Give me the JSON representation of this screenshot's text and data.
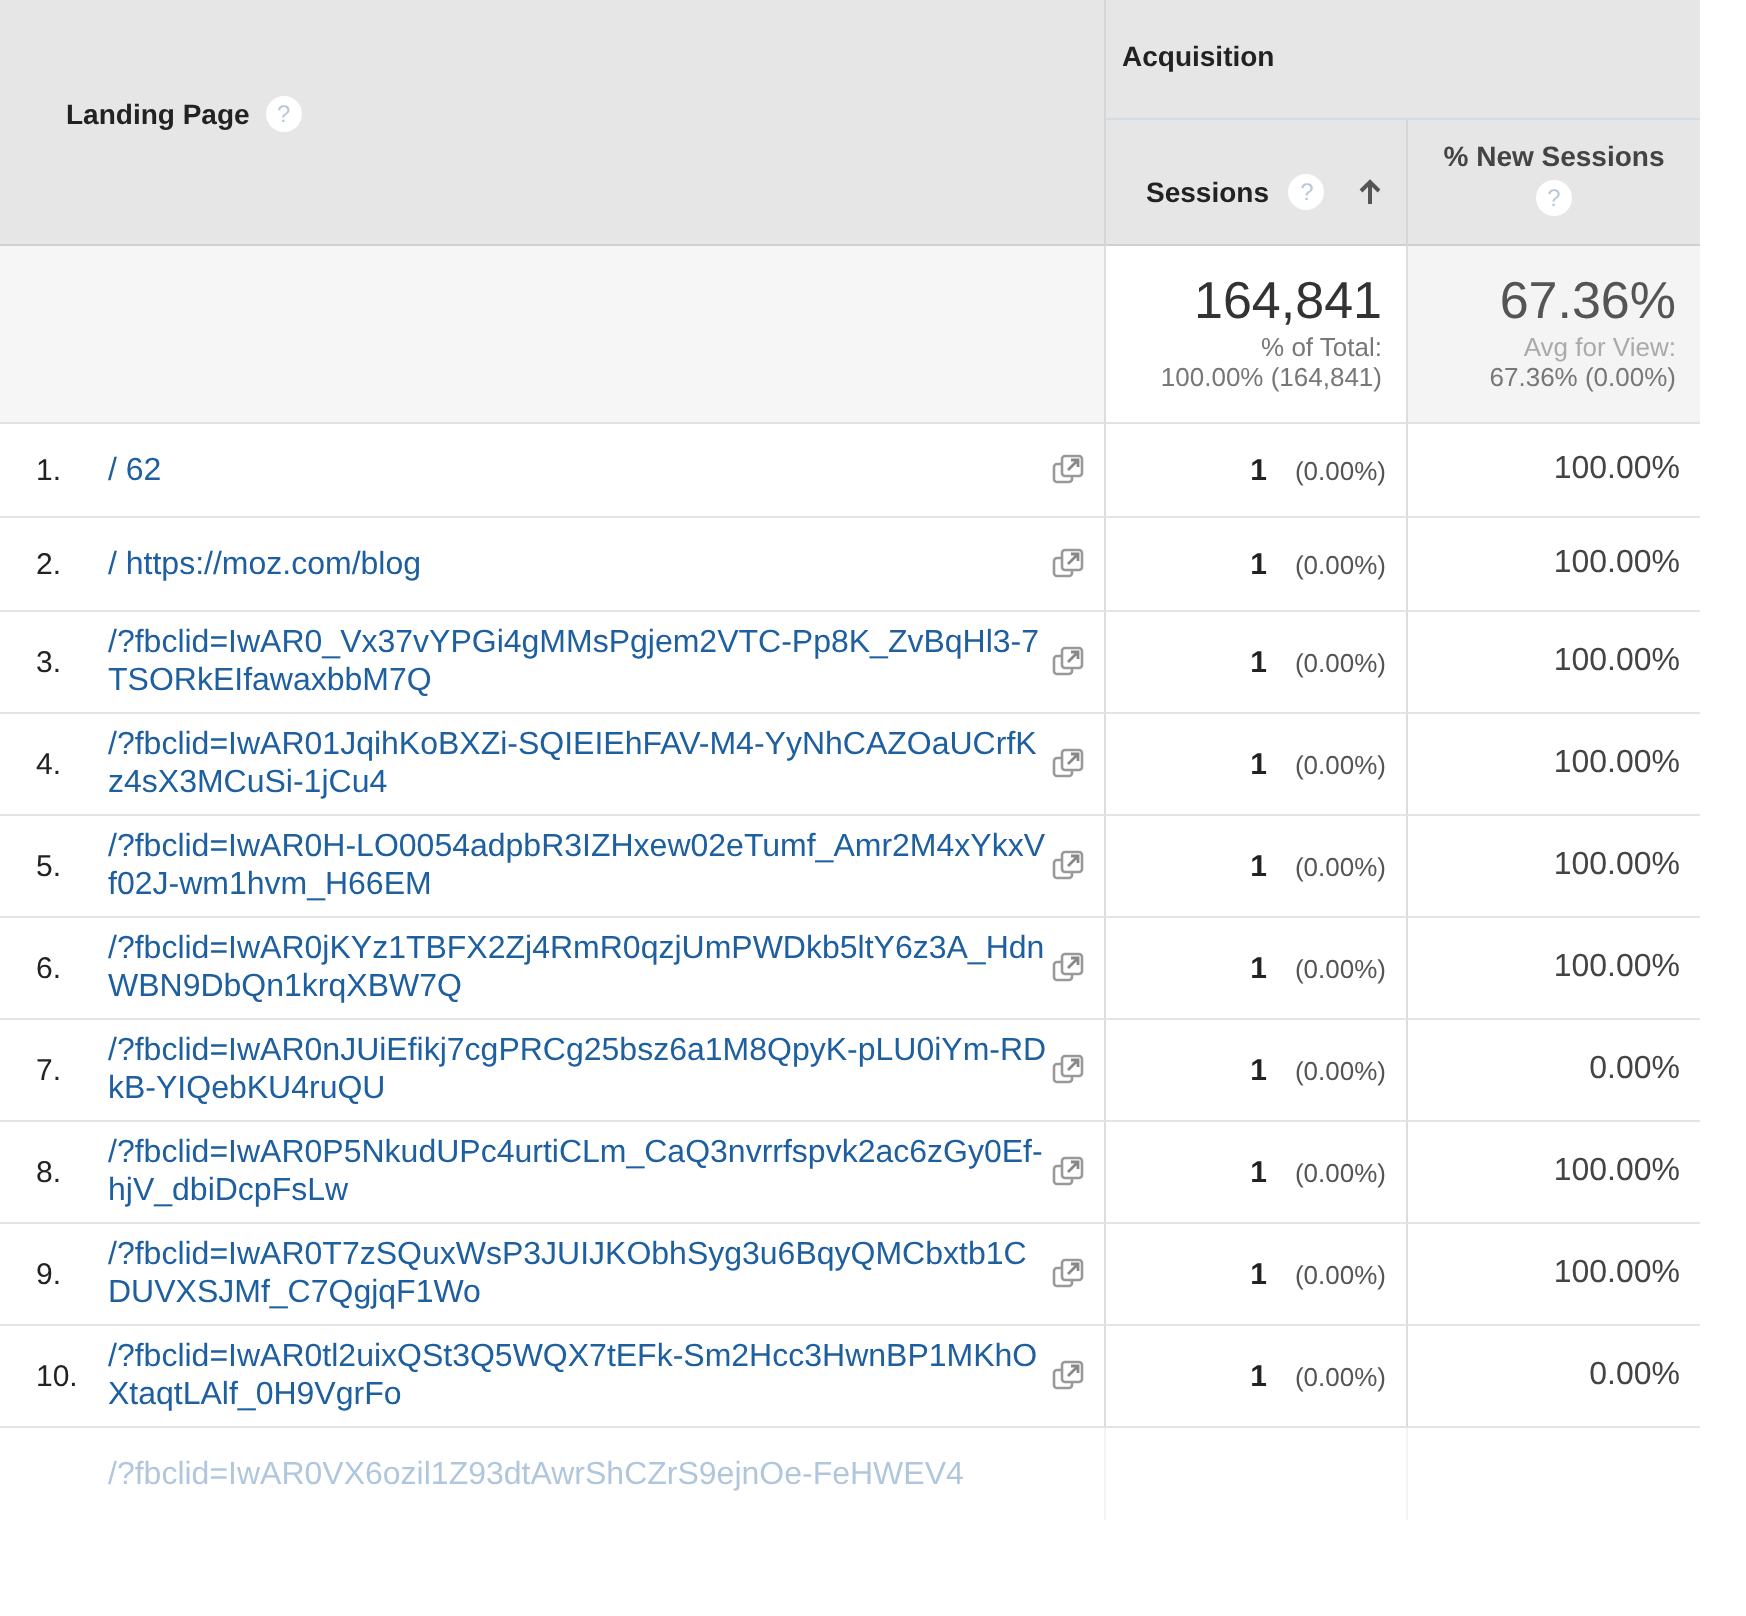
{
  "table": {
    "dimension_header": {
      "label": "Landing Page",
      "help": "?"
    },
    "group_header": "Acquisition",
    "columns": [
      {
        "label": "Sessions",
        "help": "?",
        "sorted": true
      },
      {
        "label": "% New Sessions",
        "help": "?",
        "sorted": false
      }
    ],
    "totals": [
      {
        "value": "164,841",
        "caption": "% of Total:",
        "detail": "100.00% (164,841)"
      },
      {
        "value": "67.36%",
        "caption": "Avg for View:",
        "detail": "67.36% (0.00%)"
      }
    ],
    "rows": [
      {
        "index": "1.",
        "page": "/ 62",
        "sessions": "1",
        "share": "(0.00%)",
        "new_sessions": "100.00%"
      },
      {
        "index": "2.",
        "page": "/ https://moz.com/blog",
        "sessions": "1",
        "share": "(0.00%)",
        "new_sessions": "100.00%"
      },
      {
        "index": "3.",
        "page": "/?fbclid=IwAR0_Vx37vYPGi4gMMsPgjem2VTC-Pp8K_ZvBqHl3-7TSORkEIfawaxbbM7Q",
        "sessions": "1",
        "share": "(0.00%)",
        "new_sessions": "100.00%"
      },
      {
        "index": "4.",
        "page": "/?fbclid=IwAR01JqihKoBXZi-SQIEIEhFAV-M4-YyNhCAZOaUCrfKz4sX3MCuSi-1jCu4",
        "sessions": "1",
        "share": "(0.00%)",
        "new_sessions": "100.00%"
      },
      {
        "index": "5.",
        "page": "/?fbclid=IwAR0H-LO0054adpbR3IZHxew02eTumf_Amr2M4xYkxVf02J-wm1hvm_H66EM",
        "sessions": "1",
        "share": "(0.00%)",
        "new_sessions": "100.00%"
      },
      {
        "index": "6.",
        "page": "/?fbclid=IwAR0jKYz1TBFX2Zj4RmR0qzjUmPWDkb5ltY6z3A_HdnWBN9DbQn1krqXBW7Q",
        "sessions": "1",
        "share": "(0.00%)",
        "new_sessions": "100.00%"
      },
      {
        "index": "7.",
        "page": "/?fbclid=IwAR0nJUiEfikj7cgPRCg25bsz6a1M8QpyK-pLU0iYm-RDkB-YIQebKU4ruQU",
        "sessions": "1",
        "share": "(0.00%)",
        "new_sessions": "0.00%"
      },
      {
        "index": "8.",
        "page": "/?fbclid=IwAR0P5NkudUPc4urtiCLm_CaQ3nvrrfspvk2ac6zGy0Ef-hjV_dbiDcpFsLw",
        "sessions": "1",
        "share": "(0.00%)",
        "new_sessions": "100.00%"
      },
      {
        "index": "9.",
        "page": "/?fbclid=IwAR0T7zSQuxWsP3JUIJKObhSyg3u6BqyQMCbxtb1CDUVXSJMf_C7QgjqF1Wo",
        "sessions": "1",
        "share": "(0.00%)",
        "new_sessions": "100.00%"
      },
      {
        "index": "10.",
        "page": "/?fbclid=IwAR0tl2uixQSt3Q5WQX7tEFk-Sm2Hcc3HwnBP1MKhOXtaqtLAlf_0H9VgrFo",
        "sessions": "1",
        "share": "(0.00%)",
        "new_sessions": "0.00%"
      }
    ],
    "cut_row": {
      "page": "/?fbclid=IwAR0VX6ozil1Z93dtAwrShCZrS9ejnOe-FeHWEV4"
    }
  }
}
